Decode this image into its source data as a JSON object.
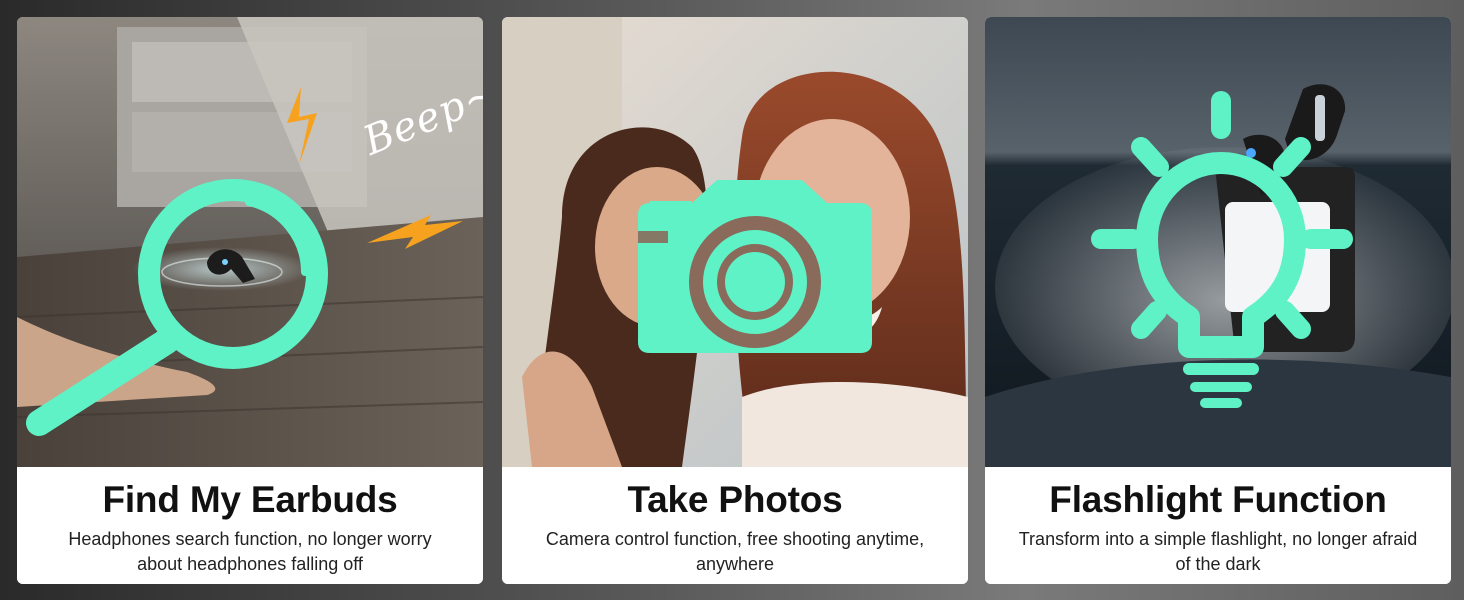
{
  "accent_color": "#5ef2c6",
  "bolt_color": "#f6a21e",
  "cards": [
    {
      "title": "Find My Earbuds",
      "description": "Headphones search function, no longer worry about headphones falling off",
      "overlay_text": "Beep~",
      "icon": "magnifier-icon"
    },
    {
      "title": "Take Photos",
      "description": "Camera control function, free shooting anytime, anywhere",
      "icon": "camera-icon"
    },
    {
      "title": "Flashlight Function",
      "description": "Transform into a simple flashlight, no longer afraid of the dark",
      "icon": "lightbulb-icon"
    }
  ]
}
